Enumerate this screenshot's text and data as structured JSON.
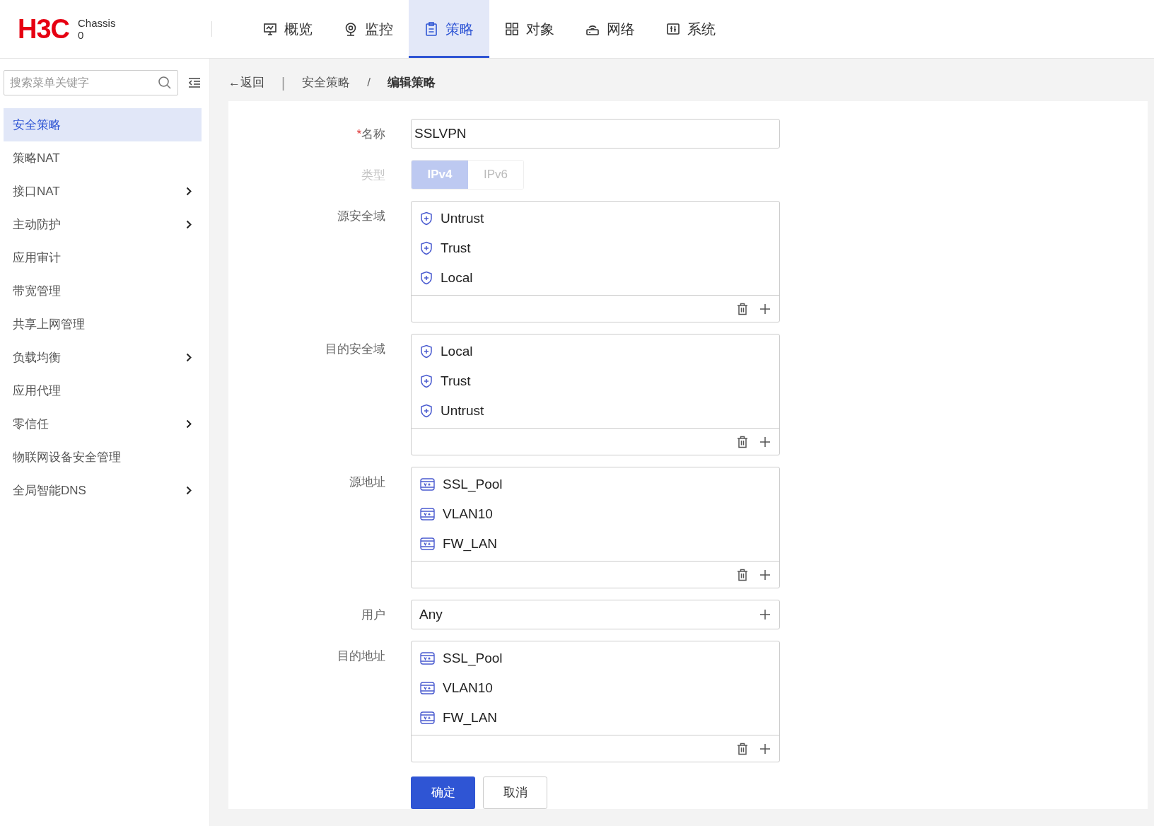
{
  "header": {
    "logo": "H3C",
    "device_label": "Chassis",
    "device_number": "0",
    "nav": [
      {
        "label": "概览",
        "selected": false
      },
      {
        "label": "监控",
        "selected": false
      },
      {
        "label": "策略",
        "selected": true
      },
      {
        "label": "对象",
        "selected": false
      },
      {
        "label": "网络",
        "selected": false
      },
      {
        "label": "系统",
        "selected": false
      }
    ]
  },
  "sidebar": {
    "search": {
      "placeholder": "搜索菜单关键字"
    },
    "items": [
      {
        "label": "安全策略",
        "selected": true,
        "expandable": false
      },
      {
        "label": "策略NAT",
        "selected": false,
        "expandable": false
      },
      {
        "label": "接口NAT",
        "selected": false,
        "expandable": true
      },
      {
        "label": "主动防护",
        "selected": false,
        "expandable": true
      },
      {
        "label": "应用审计",
        "selected": false,
        "expandable": false
      },
      {
        "label": "带宽管理",
        "selected": false,
        "expandable": false
      },
      {
        "label": "共享上网管理",
        "selected": false,
        "expandable": false
      },
      {
        "label": "负载均衡",
        "selected": false,
        "expandable": true
      },
      {
        "label": "应用代理",
        "selected": false,
        "expandable": false
      },
      {
        "label": "零信任",
        "selected": false,
        "expandable": true
      },
      {
        "label": "物联网设备安全管理",
        "selected": false,
        "expandable": false
      },
      {
        "label": "全局智能DNS",
        "selected": false,
        "expandable": true
      }
    ]
  },
  "breadcrumb": {
    "back": "←返回",
    "separator": "|",
    "items": [
      "安全策略",
      "编辑策略"
    ],
    "divider": "/"
  },
  "form": {
    "fields": [
      {
        "kind": "text",
        "label": "名称",
        "required_mark": "*",
        "value": "SSLVPN"
      },
      {
        "kind": "toggle",
        "label": "类型",
        "disabled": true,
        "options": [
          {
            "label": "IPv4",
            "selected": true
          },
          {
            "label": "IPv6",
            "selected": false
          }
        ]
      },
      {
        "kind": "zone_list",
        "label": "源安全域",
        "items": [
          "Untrust",
          "Trust",
          "Local"
        ]
      },
      {
        "kind": "zone_list",
        "label": "目的安全域",
        "items": [
          "Local",
          "Trust",
          "Untrust"
        ]
      },
      {
        "kind": "address_list",
        "label": "源地址",
        "items": [
          "SSL_Pool",
          "VLAN10",
          "FW_LAN"
        ]
      },
      {
        "kind": "single",
        "label": "用户",
        "value": "Any"
      },
      {
        "kind": "address_list",
        "label": "目的地址",
        "items": [
          "SSL_Pool",
          "VLAN10",
          "FW_LAN"
        ]
      }
    ],
    "buttons": [
      {
        "label": "确定",
        "kind": "primary"
      },
      {
        "label": "取消",
        "kind": "secondary"
      }
    ]
  }
}
